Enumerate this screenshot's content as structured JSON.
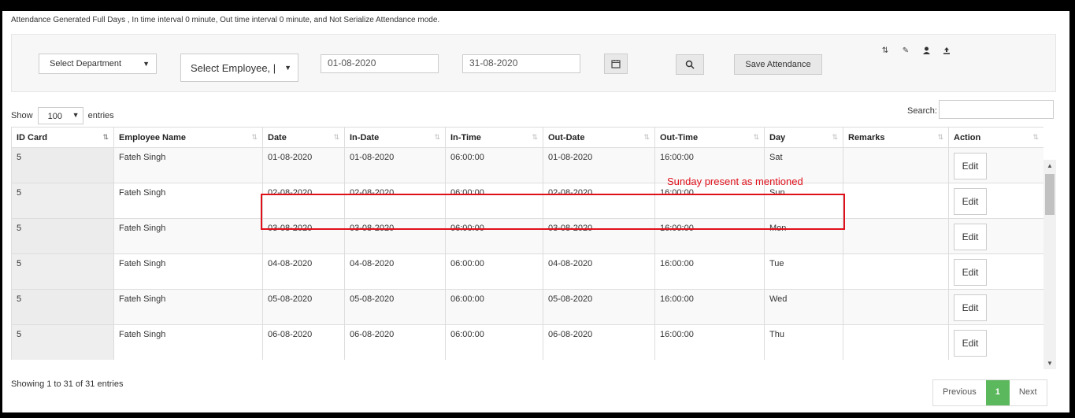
{
  "info": "Attendance Generated Full Days , In time interval 0 minute, Out time interval 0 minute, and Not Serialize Attendance mode.",
  "filters": {
    "department": "Select Department",
    "employee": "Select Employee, |",
    "from_date": "01-08-2020",
    "to_date": "31-08-2020",
    "save_label": "Save Attendance"
  },
  "toolbar_icons": [
    "sort-icon",
    "edit-icon",
    "user-icon",
    "upload-icon"
  ],
  "length": {
    "show": "Show",
    "value": "100",
    "entries": "entries"
  },
  "search_label": "Search:",
  "columns": [
    "ID Card",
    "Employee Name",
    "Date",
    "In-Date",
    "In-Time",
    "Out-Date",
    "Out-Time",
    "Day",
    "Remarks",
    "Action"
  ],
  "rows": [
    {
      "id": "5",
      "name": "Fateh Singh",
      "date": "01-08-2020",
      "in_date": "01-08-2020",
      "in_time": "06:00:00",
      "out_date": "01-08-2020",
      "out_time": "16:00:00",
      "day": "Sat",
      "remarks": "",
      "action": "Edit"
    },
    {
      "id": "5",
      "name": "Fateh Singh",
      "date": "02-08-2020",
      "in_date": "02-08-2020",
      "in_time": "06:00:00",
      "out_date": "02-08-2020",
      "out_time": "16:00:00",
      "day": "Sun",
      "remarks": "",
      "action": "Edit"
    },
    {
      "id": "5",
      "name": "Fateh Singh",
      "date": "03-08-2020",
      "in_date": "03-08-2020",
      "in_time": "06:00:00",
      "out_date": "03-08-2020",
      "out_time": "16:00:00",
      "day": "Mon",
      "remarks": "",
      "action": "Edit"
    },
    {
      "id": "5",
      "name": "Fateh Singh",
      "date": "04-08-2020",
      "in_date": "04-08-2020",
      "in_time": "06:00:00",
      "out_date": "04-08-2020",
      "out_time": "16:00:00",
      "day": "Tue",
      "remarks": "",
      "action": "Edit"
    },
    {
      "id": "5",
      "name": "Fateh Singh",
      "date": "05-08-2020",
      "in_date": "05-08-2020",
      "in_time": "06:00:00",
      "out_date": "05-08-2020",
      "out_time": "16:00:00",
      "day": "Wed",
      "remarks": "",
      "action": "Edit"
    },
    {
      "id": "5",
      "name": "Fateh Singh",
      "date": "06-08-2020",
      "in_date": "06-08-2020",
      "in_time": "06:00:00",
      "out_date": "06-08-2020",
      "out_time": "16:00:00",
      "day": "Thu",
      "remarks": "",
      "action": "Edit"
    }
  ],
  "annotation": "Sunday present as mentioned",
  "footer": "Showing 1 to 31 of 31 entries",
  "pagination": {
    "previous": "Previous",
    "current": "1",
    "next": "Next"
  },
  "colors": {
    "annotation": "#e0101a",
    "active_page": "#5cb85c"
  }
}
